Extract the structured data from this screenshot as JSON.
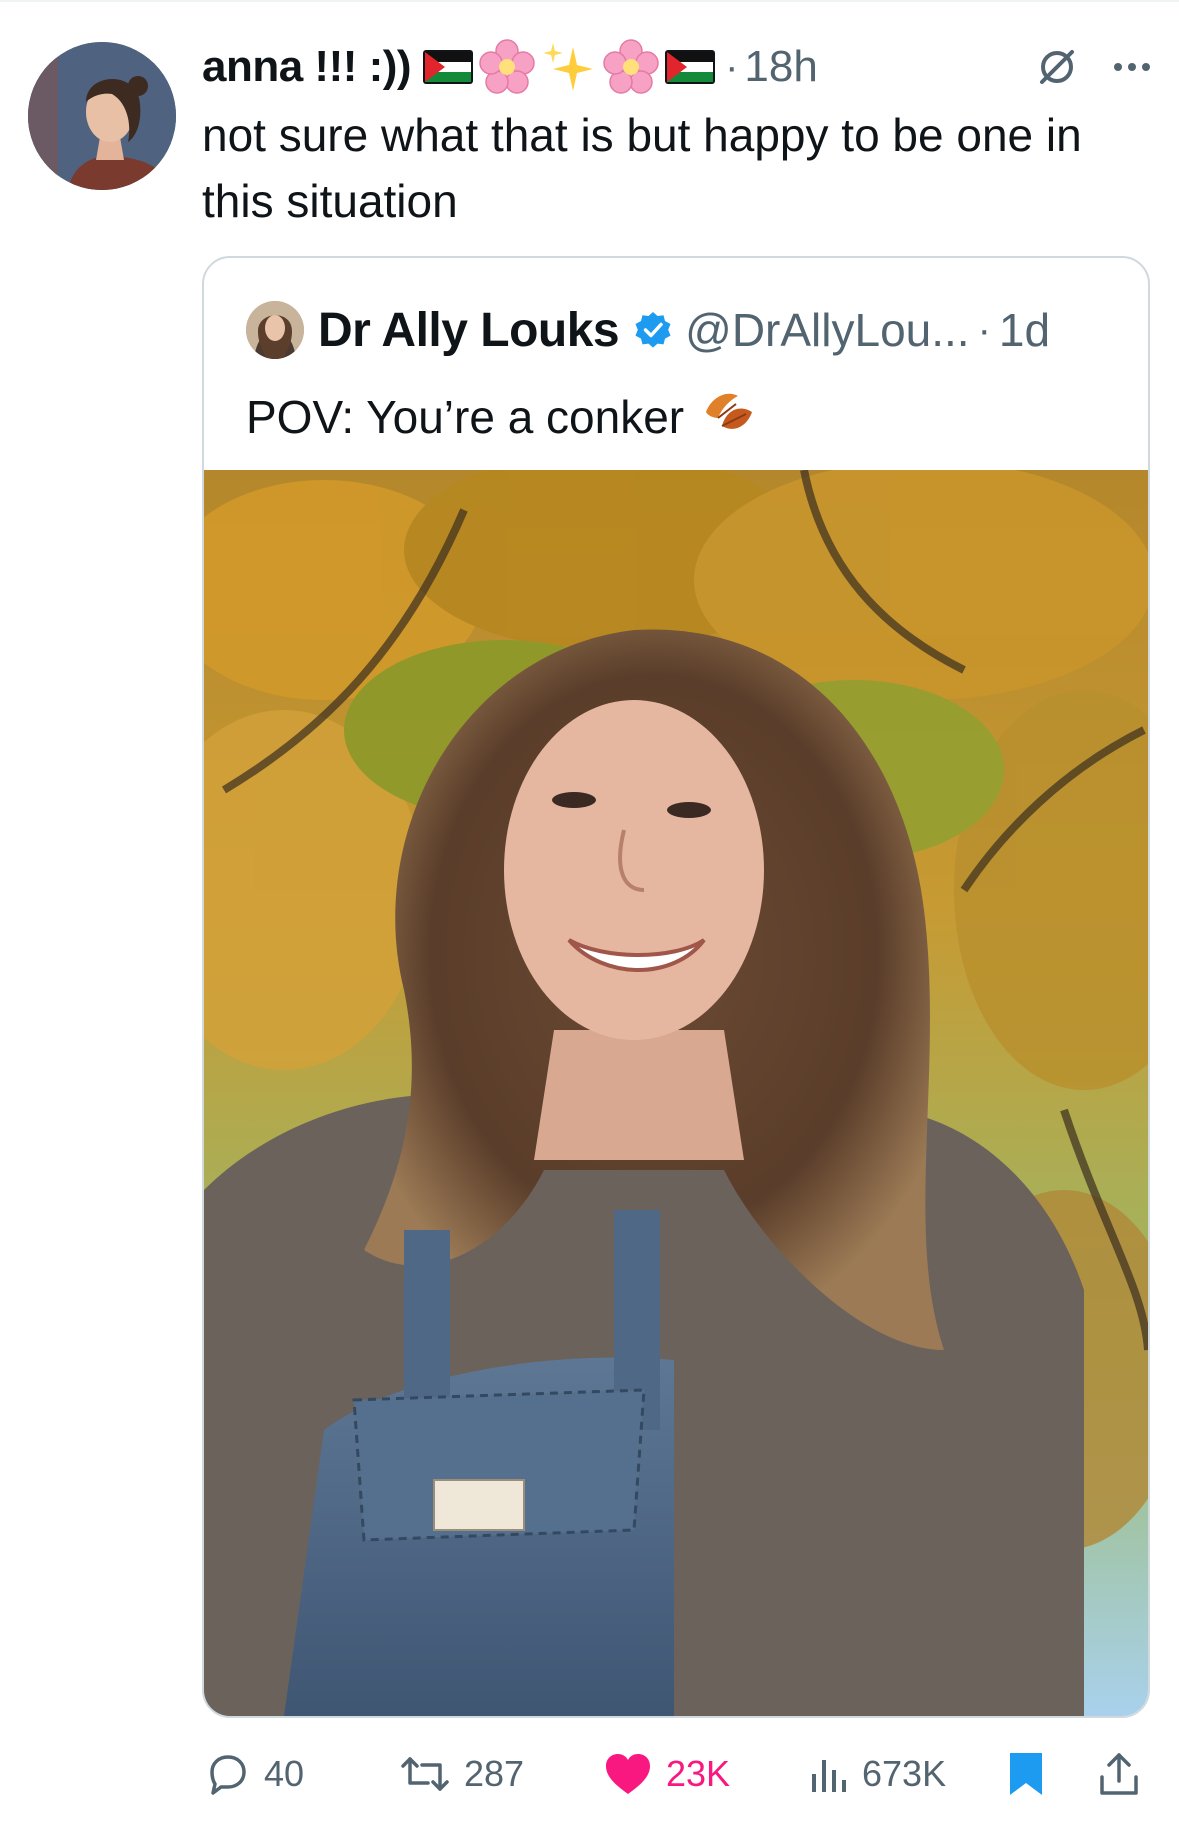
{
  "tweet": {
    "author": {
      "display_name": "anna !!! :))",
      "emojis": [
        "palestine-flag-icon",
        "cherry-blossom-icon",
        "sparkles-icon",
        "cherry-blossom-icon",
        "palestine-flag-icon"
      ]
    },
    "separator": "·",
    "time": "18h",
    "text": "not sure what that is but happy to be one in this situation",
    "actions": {
      "replies": "40",
      "retweets": "287",
      "likes": "23K",
      "views": "673K"
    }
  },
  "quoted_tweet": {
    "display_name": "Dr Ally Louks",
    "verified": true,
    "handle": "@DrAllyLou...",
    "separator": "·",
    "time": "1d",
    "text": "POV: You’re a conker",
    "text_emoji": "fallen-leaf-icon"
  },
  "colors": {
    "text_primary": "#0f1419",
    "text_secondary": "#536471",
    "like_pink": "#f91880",
    "brand_blue": "#1d9bf0",
    "border": "#cfd9de"
  }
}
